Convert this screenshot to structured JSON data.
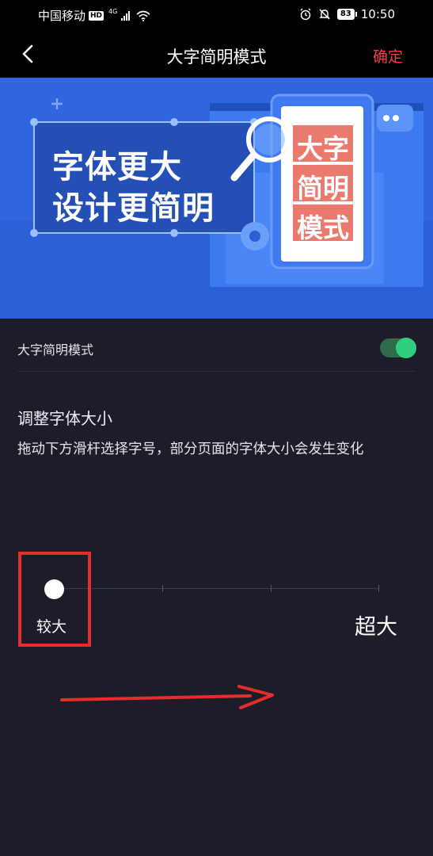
{
  "status_bar": {
    "carrier": "中国移动",
    "hd": "HD",
    "network": "4G",
    "battery": "83",
    "time": "10:50",
    "icons": [
      "signal-icon",
      "wifi-icon",
      "alarm-icon",
      "mute-icon",
      "battery-icon"
    ]
  },
  "nav": {
    "title": "大字简明模式",
    "confirm": "确定",
    "back_icon": "back-icon"
  },
  "banner": {
    "headline_line1": "字体更大",
    "headline_line2": "设计更简明",
    "phone_text": [
      "大字",
      "简明",
      "模式"
    ]
  },
  "settings": {
    "simple_mode_label": "大字简明模式",
    "simple_mode_on": true
  },
  "font_size": {
    "title": "调整字体大小",
    "description": "拖动下方滑杆选择字号，部分页面的字体大小会发生变化",
    "current_label": "较大",
    "max_label": "超大",
    "position_index": 0,
    "tick_count": 4
  },
  "colors": {
    "accent_red": "#ff3b4a",
    "toggle_green": "#2fcf7f",
    "banner_blue": "#2f6ae5",
    "background": "#1c1d28"
  }
}
